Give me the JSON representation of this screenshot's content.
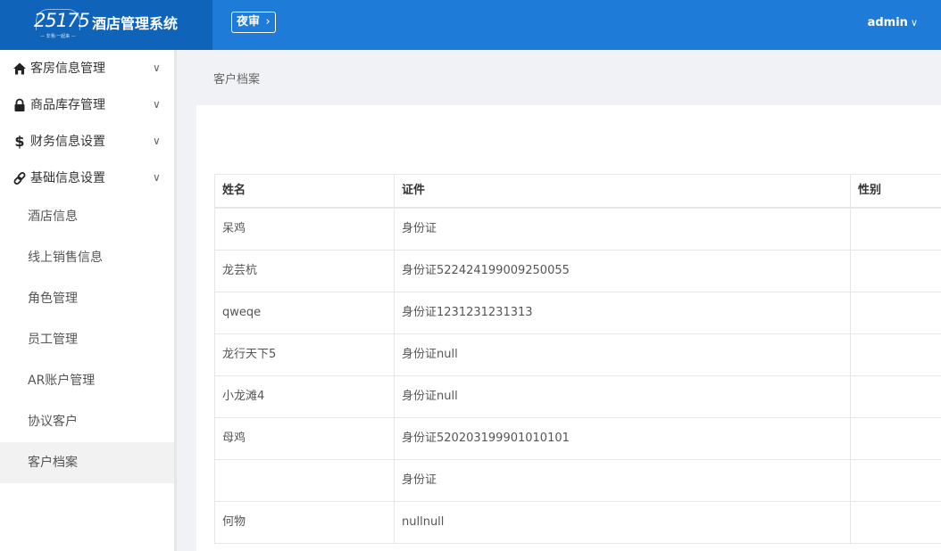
{
  "header": {
    "logo_number": "25175",
    "logo_slogan": "— 非我·一起来 —",
    "app_title": "酒店管理系统",
    "night_audit_label": "夜审",
    "user_label": "admin"
  },
  "sidebar": {
    "groups": [
      {
        "label": "客房信息管理",
        "icon": "home-icon"
      },
      {
        "label": "商品库存管理",
        "icon": "lock-icon"
      },
      {
        "label": "财务信息设置",
        "icon": "dollar-icon"
      },
      {
        "label": "基础信息设置",
        "icon": "link-icon"
      }
    ],
    "items": [
      {
        "label": "酒店信息"
      },
      {
        "label": "线上销售信息"
      },
      {
        "label": "角色管理"
      },
      {
        "label": "员工管理"
      },
      {
        "label": "AR账户管理"
      },
      {
        "label": "协议客户"
      },
      {
        "label": "客户档案"
      }
    ],
    "active_item": "客户档案"
  },
  "breadcrumb": "客户档案",
  "table": {
    "columns": [
      "姓名",
      "证件",
      "性别"
    ],
    "rows": [
      {
        "name": "呆鸡",
        "id_doc": "身份证",
        "gender": ""
      },
      {
        "name": "龙芸杭",
        "id_doc": "身份证522424199009250055",
        "gender": ""
      },
      {
        "name": "qweqe",
        "id_doc": "身份证1231231231313",
        "gender": ""
      },
      {
        "name": "龙行天下5",
        "id_doc": "身份证null",
        "gender": ""
      },
      {
        "name": "小龙滩4",
        "id_doc": "身份证null",
        "gender": ""
      },
      {
        "name": "母鸡",
        "id_doc": "身份证520203199901010101",
        "gender": ""
      },
      {
        "name": "",
        "id_doc": "身份证",
        "gender": ""
      },
      {
        "name": "何物",
        "id_doc": "nullnull",
        "gender": ""
      }
    ]
  },
  "colors": {
    "topbar": "#1e7bd8",
    "brand": "#0f63b8",
    "page_bg": "#f0f2f5",
    "active_item_bg": "#f2f2f2"
  }
}
